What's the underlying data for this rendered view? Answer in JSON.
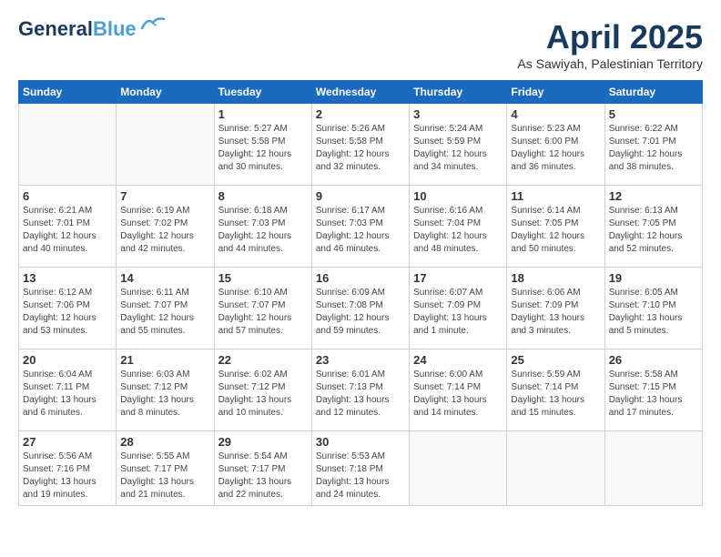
{
  "logo": {
    "line1": "General",
    "line2": "Blue"
  },
  "title": "April 2025",
  "subtitle": "As Sawiyah, Palestinian Territory",
  "days_of_week": [
    "Sunday",
    "Monday",
    "Tuesday",
    "Wednesday",
    "Thursday",
    "Friday",
    "Saturday"
  ],
  "weeks": [
    [
      {
        "day": "",
        "info": ""
      },
      {
        "day": "",
        "info": ""
      },
      {
        "day": "1",
        "info": "Sunrise: 5:27 AM\nSunset: 5:58 PM\nDaylight: 12 hours\nand 30 minutes."
      },
      {
        "day": "2",
        "info": "Sunrise: 5:26 AM\nSunset: 5:58 PM\nDaylight: 12 hours\nand 32 minutes."
      },
      {
        "day": "3",
        "info": "Sunrise: 5:24 AM\nSunset: 5:59 PM\nDaylight: 12 hours\nand 34 minutes."
      },
      {
        "day": "4",
        "info": "Sunrise: 5:23 AM\nSunset: 6:00 PM\nDaylight: 12 hours\nand 36 minutes."
      },
      {
        "day": "5",
        "info": "Sunrise: 6:22 AM\nSunset: 7:01 PM\nDaylight: 12 hours\nand 38 minutes."
      }
    ],
    [
      {
        "day": "6",
        "info": "Sunrise: 6:21 AM\nSunset: 7:01 PM\nDaylight: 12 hours\nand 40 minutes."
      },
      {
        "day": "7",
        "info": "Sunrise: 6:19 AM\nSunset: 7:02 PM\nDaylight: 12 hours\nand 42 minutes."
      },
      {
        "day": "8",
        "info": "Sunrise: 6:18 AM\nSunset: 7:03 PM\nDaylight: 12 hours\nand 44 minutes."
      },
      {
        "day": "9",
        "info": "Sunrise: 6:17 AM\nSunset: 7:03 PM\nDaylight: 12 hours\nand 46 minutes."
      },
      {
        "day": "10",
        "info": "Sunrise: 6:16 AM\nSunset: 7:04 PM\nDaylight: 12 hours\nand 48 minutes."
      },
      {
        "day": "11",
        "info": "Sunrise: 6:14 AM\nSunset: 7:05 PM\nDaylight: 12 hours\nand 50 minutes."
      },
      {
        "day": "12",
        "info": "Sunrise: 6:13 AM\nSunset: 7:05 PM\nDaylight: 12 hours\nand 52 minutes."
      }
    ],
    [
      {
        "day": "13",
        "info": "Sunrise: 6:12 AM\nSunset: 7:06 PM\nDaylight: 12 hours\nand 53 minutes."
      },
      {
        "day": "14",
        "info": "Sunrise: 6:11 AM\nSunset: 7:07 PM\nDaylight: 12 hours\nand 55 minutes."
      },
      {
        "day": "15",
        "info": "Sunrise: 6:10 AM\nSunset: 7:07 PM\nDaylight: 12 hours\nand 57 minutes."
      },
      {
        "day": "16",
        "info": "Sunrise: 6:09 AM\nSunset: 7:08 PM\nDaylight: 12 hours\nand 59 minutes."
      },
      {
        "day": "17",
        "info": "Sunrise: 6:07 AM\nSunset: 7:09 PM\nDaylight: 13 hours\nand 1 minute."
      },
      {
        "day": "18",
        "info": "Sunrise: 6:06 AM\nSunset: 7:09 PM\nDaylight: 13 hours\nand 3 minutes."
      },
      {
        "day": "19",
        "info": "Sunrise: 6:05 AM\nSunset: 7:10 PM\nDaylight: 13 hours\nand 5 minutes."
      }
    ],
    [
      {
        "day": "20",
        "info": "Sunrise: 6:04 AM\nSunset: 7:11 PM\nDaylight: 13 hours\nand 6 minutes."
      },
      {
        "day": "21",
        "info": "Sunrise: 6:03 AM\nSunset: 7:12 PM\nDaylight: 13 hours\nand 8 minutes."
      },
      {
        "day": "22",
        "info": "Sunrise: 6:02 AM\nSunset: 7:12 PM\nDaylight: 13 hours\nand 10 minutes."
      },
      {
        "day": "23",
        "info": "Sunrise: 6:01 AM\nSunset: 7:13 PM\nDaylight: 13 hours\nand 12 minutes."
      },
      {
        "day": "24",
        "info": "Sunrise: 6:00 AM\nSunset: 7:14 PM\nDaylight: 13 hours\nand 14 minutes."
      },
      {
        "day": "25",
        "info": "Sunrise: 5:59 AM\nSunset: 7:14 PM\nDaylight: 13 hours\nand 15 minutes."
      },
      {
        "day": "26",
        "info": "Sunrise: 5:58 AM\nSunset: 7:15 PM\nDaylight: 13 hours\nand 17 minutes."
      }
    ],
    [
      {
        "day": "27",
        "info": "Sunrise: 5:56 AM\nSunset: 7:16 PM\nDaylight: 13 hours\nand 19 minutes."
      },
      {
        "day": "28",
        "info": "Sunrise: 5:55 AM\nSunset: 7:17 PM\nDaylight: 13 hours\nand 21 minutes."
      },
      {
        "day": "29",
        "info": "Sunrise: 5:54 AM\nSunset: 7:17 PM\nDaylight: 13 hours\nand 22 minutes."
      },
      {
        "day": "30",
        "info": "Sunrise: 5:53 AM\nSunset: 7:18 PM\nDaylight: 13 hours\nand 24 minutes."
      },
      {
        "day": "",
        "info": ""
      },
      {
        "day": "",
        "info": ""
      },
      {
        "day": "",
        "info": ""
      }
    ]
  ]
}
